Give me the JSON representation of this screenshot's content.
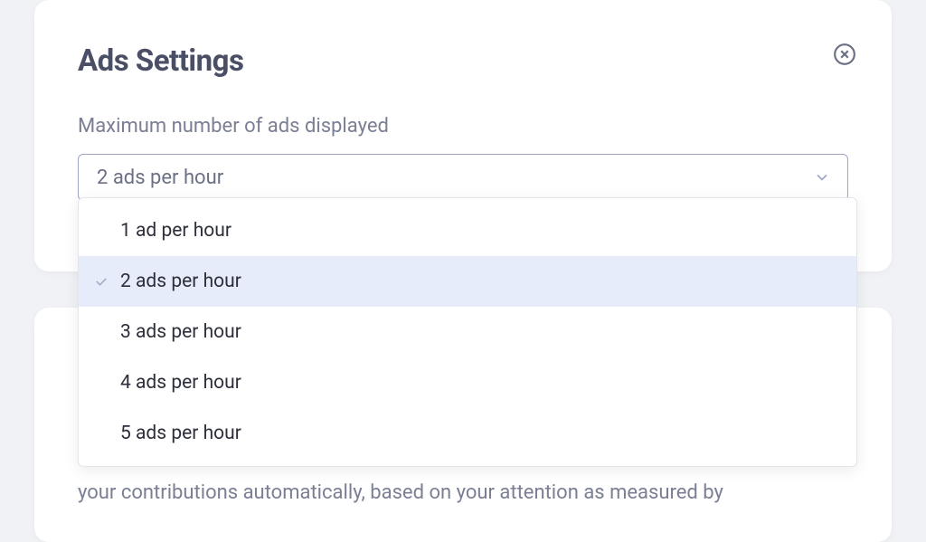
{
  "settings": {
    "title": "Ads Settings",
    "field_label": "Maximum number of ads displayed",
    "selected_value": "2 ads per hour",
    "options": [
      {
        "label": "1 ad per hour",
        "selected": false
      },
      {
        "label": "2 ads per hour",
        "selected": true
      },
      {
        "label": "3 ads per hour",
        "selected": false
      },
      {
        "label": "4 ads per hour",
        "selected": false
      },
      {
        "label": "5 ads per hour",
        "selected": false
      }
    ]
  },
  "body_text": "your contributions automatically, based on your attention as measured by"
}
